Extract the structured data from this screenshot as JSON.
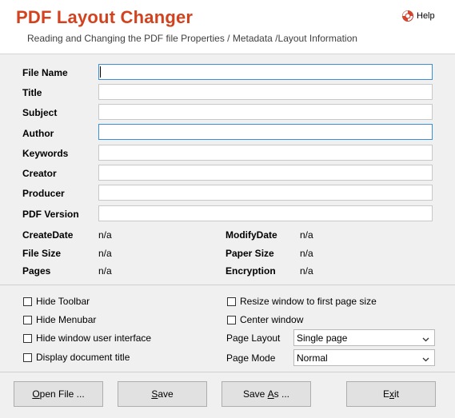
{
  "header": {
    "title": "PDF Layout Changer",
    "subtitle": "Reading and Changing the PDF file Properties / Metadata /Layout Information",
    "help_label": "Help",
    "help_icon": "lifebuoy-icon"
  },
  "fields": [
    {
      "label": "File Name",
      "value": ""
    },
    {
      "label": "Title",
      "value": ""
    },
    {
      "label": "Subject",
      "value": ""
    },
    {
      "label": "Author",
      "value": ""
    },
    {
      "label": "Keywords",
      "value": ""
    },
    {
      "label": "Creator",
      "value": ""
    },
    {
      "label": "Producer",
      "value": ""
    },
    {
      "label": "PDF Version",
      "value": ""
    }
  ],
  "info": {
    "create_date": {
      "label": "CreateDate",
      "value": "n/a"
    },
    "modify_date": {
      "label": "ModifyDate",
      "value": "n/a"
    },
    "file_size": {
      "label": "File Size",
      "value": "n/a"
    },
    "paper_size": {
      "label": "Paper Size",
      "value": "n/a"
    },
    "pages": {
      "label": "Pages",
      "value": "n/a"
    },
    "encryption": {
      "label": "Encryption",
      "value": "n/a"
    }
  },
  "options": {
    "hide_toolbar": {
      "label": "Hide Toolbar",
      "checked": false
    },
    "hide_menubar": {
      "label": "Hide Menubar",
      "checked": false
    },
    "hide_window_ui": {
      "label": "Hide window user interface",
      "checked": false
    },
    "display_doc_title": {
      "label": "Display document title",
      "checked": false
    },
    "resize_window": {
      "label": "Resize window to first page size",
      "checked": false
    },
    "center_window": {
      "label": "Center window",
      "checked": false
    },
    "page_layout": {
      "label": "Page Layout",
      "value": "Single page"
    },
    "page_mode": {
      "label": "Page Mode",
      "value": "Normal"
    }
  },
  "buttons": {
    "open_file": {
      "label": "Open File ...",
      "mnemonic": "O",
      "rest": "pen File ..."
    },
    "save": {
      "label": "Save",
      "mnemonic": "S",
      "rest": "ave"
    },
    "save_as": {
      "label": "Save As ...",
      "prefix": "Save ",
      "mnemonic": "A",
      "rest": "s ..."
    },
    "exit": {
      "label": "Exit",
      "prefix": "E",
      "mnemonic": "x",
      "rest": "it"
    }
  },
  "colors": {
    "title": "#d2421e",
    "focus_border": "#3c8ed6",
    "background": "#f0f0f0"
  }
}
